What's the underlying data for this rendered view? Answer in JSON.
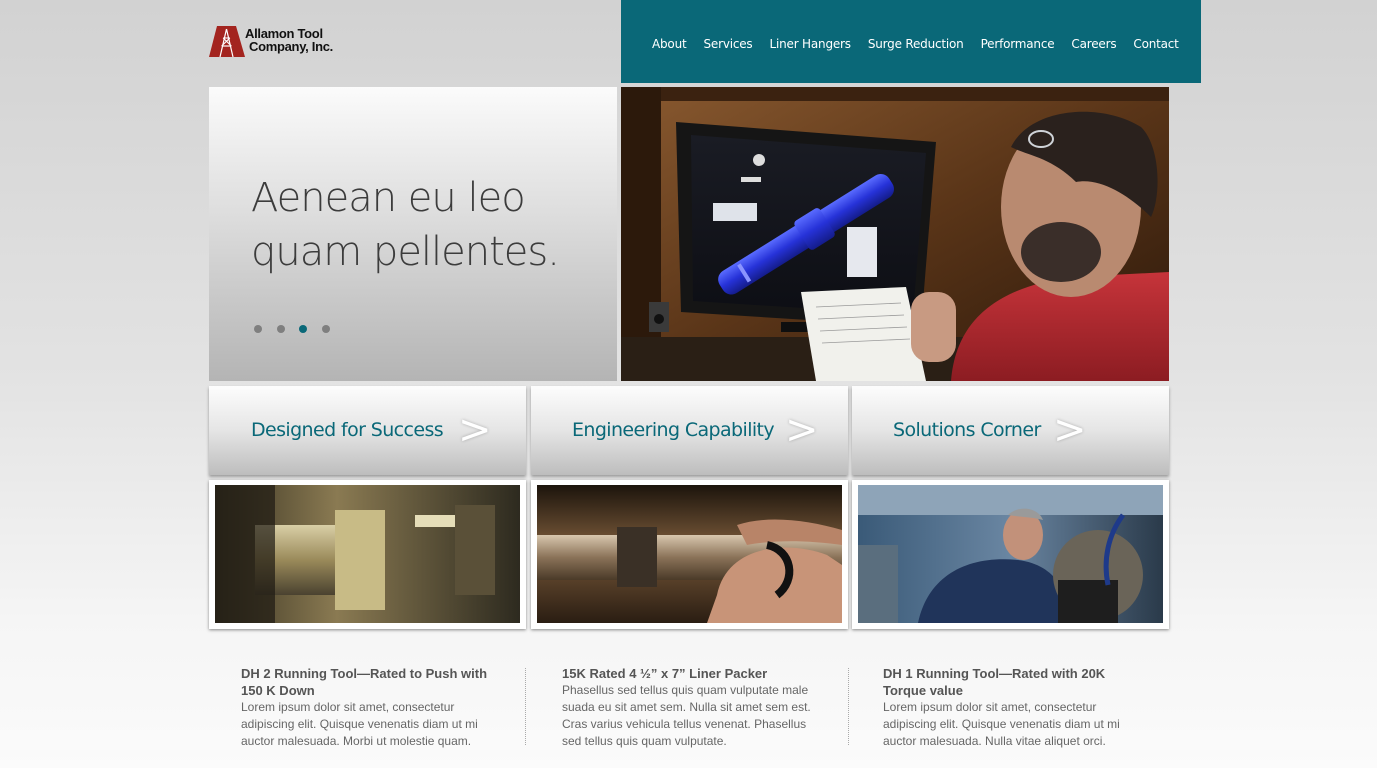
{
  "logo": {
    "line1": "Allamon Tool",
    "line2": "Company, Inc."
  },
  "nav": {
    "items": [
      "About",
      "Services",
      "Liner Hangers",
      "Surge Reduction",
      "Performance",
      "Careers",
      "Contact"
    ]
  },
  "hero": {
    "headline": "Aenean eu leo quam pellentes.",
    "slides": {
      "count": 4,
      "active_index": 2
    }
  },
  "features": [
    {
      "title": "Designed for Success",
      "arrow": ">"
    },
    {
      "title": "Engineering Capability",
      "arrow": ">"
    },
    {
      "title": "Solutions Corner",
      "arrow": ">"
    }
  ],
  "news": [
    {
      "title": "DH 2 Running Tool—Rated to Push with 150 K Down",
      "body": "Lorem ipsum dolor sit amet, consectetur adipiscing elit. Quisque venenatis diam ut mi auctor malesuada. Morbi ut molestie quam."
    },
    {
      "title": "15K Rated 4 ½” x 7” Liner Packer",
      "body": "Phasellus sed tellus quis quam vulputate male suada eu sit amet sem. Nulla sit amet sem est. Cras varius vehicula tellus venenat. Phasellus sed tellus quis quam vulputate."
    },
    {
      "title": "DH 1  Running Tool—Rated with 20K Torque value",
      "body": "Lorem ipsum dolor sit amet, consectetur adipiscing elit. Quisque venenatis diam ut mi auctor malesuada. Nulla vitae aliquet orci."
    }
  ],
  "colors": {
    "brand_teal": "#0a6878",
    "logo_red": "#a3241f"
  },
  "icons": {
    "logo_mark": "derrick-logo-icon",
    "feature_arrow": "chevron-right-icon"
  }
}
